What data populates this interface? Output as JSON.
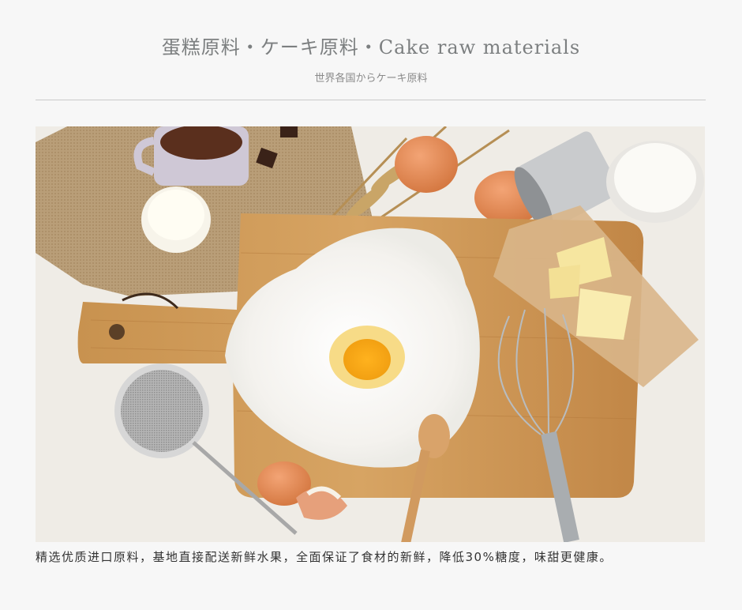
{
  "header": {
    "title": "蛋糕原料・ケーキ原料・Cake raw materials",
    "subtitle": "世界各国からケーキ原料"
  },
  "photo": {
    "name": "cake ingredients still life"
  },
  "description": "精选优质进口原料，基地直接配送新鲜水果，全面保证了食材的新鲜，降低30%糖度，味甜更健康。"
}
